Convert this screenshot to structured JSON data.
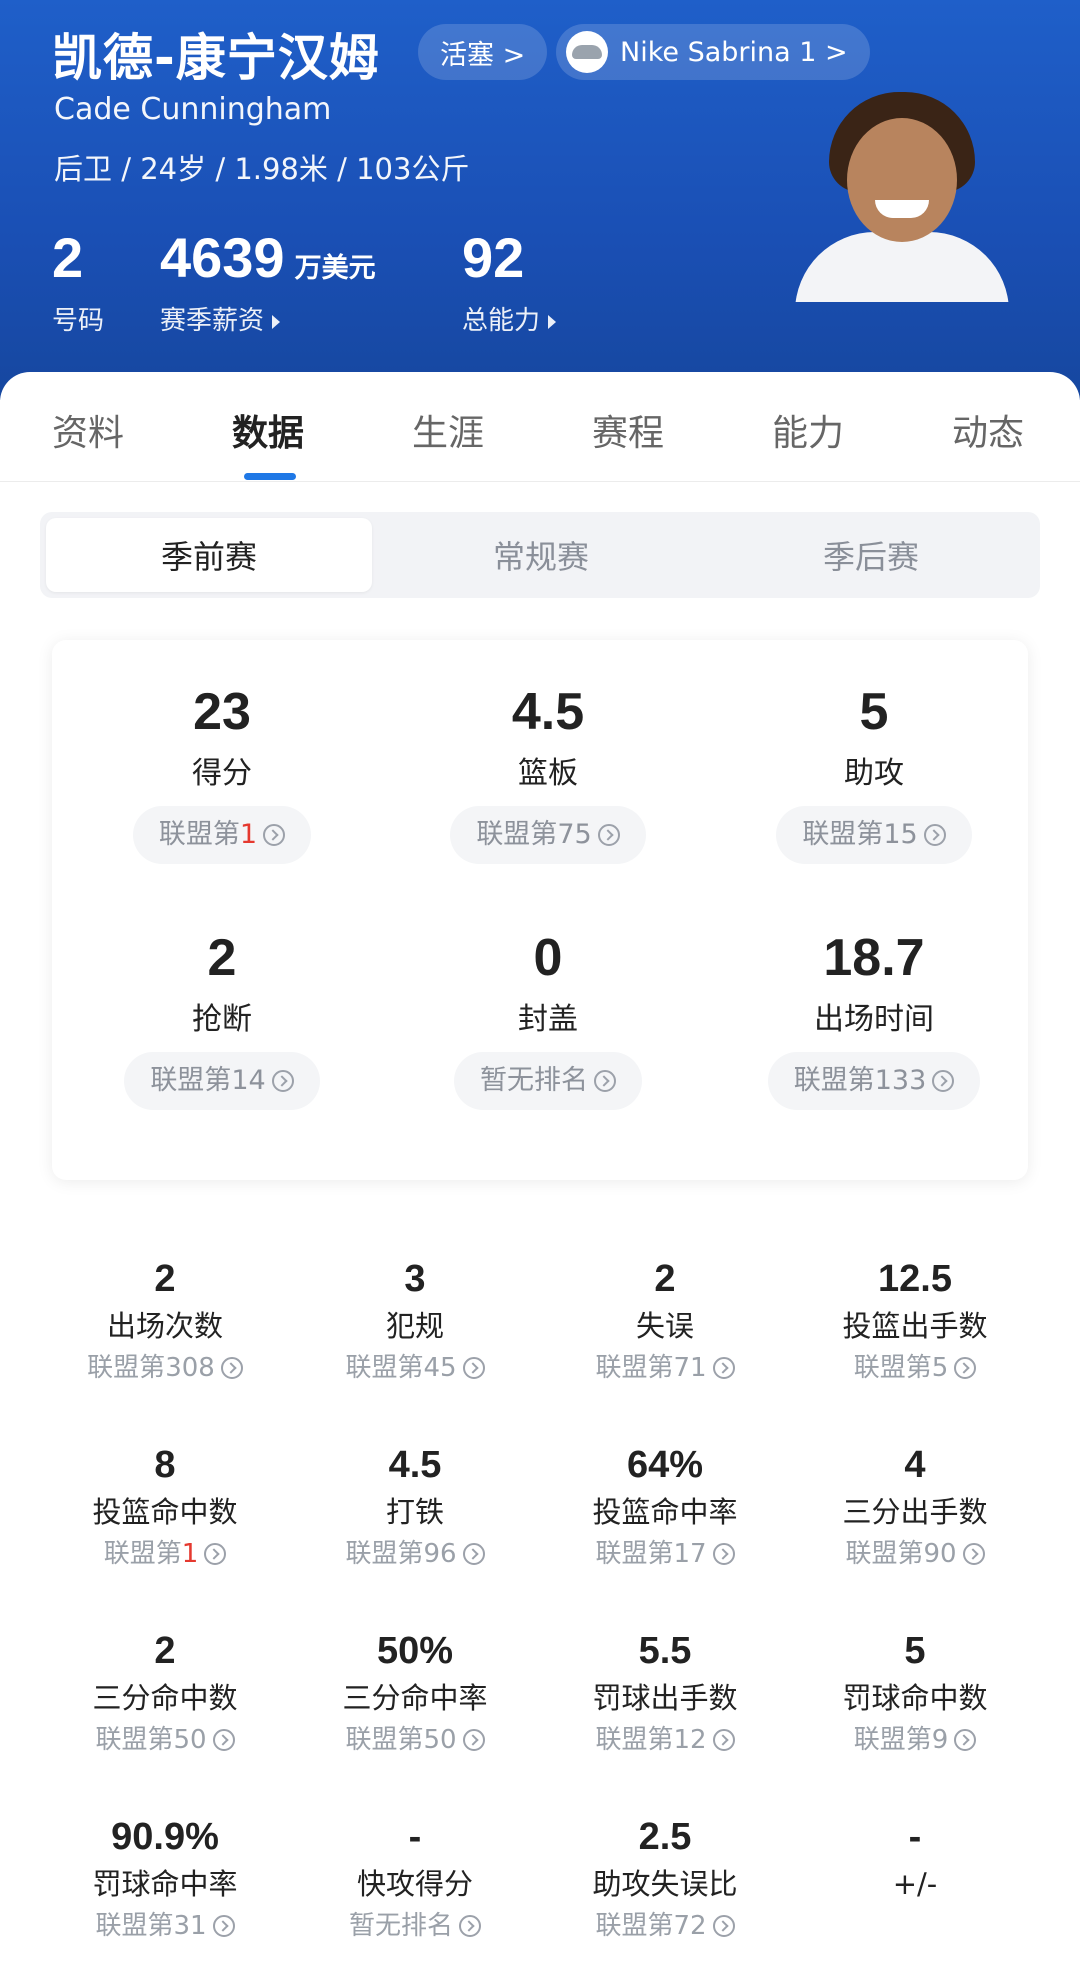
{
  "player": {
    "name_cn": "凯德-康宁汉姆",
    "name_en": "Cade Cunningham",
    "team_label": "活塞 >",
    "shoe_label": "Nike Sabrina 1 >",
    "bio": "后卫 / 24岁 / 1.98米 / 103公斤",
    "number": "2",
    "number_label": "号码",
    "salary": "4639",
    "salary_unit": "万美元",
    "salary_label": "赛季薪资",
    "rating": "92",
    "rating_label": "总能力",
    "accent": "#1f5fc9"
  },
  "tabs": [
    "资料",
    "数据",
    "生涯",
    "赛程",
    "能力",
    "动态"
  ],
  "active_tab": "数据",
  "season_types": [
    "季前赛",
    "常规赛",
    "季后赛"
  ],
  "active_season_type": "季前赛",
  "main_stats": [
    {
      "value": "23",
      "label": "得分",
      "rank_prefix": "联盟第",
      "rank_num": "1",
      "highlight": true
    },
    {
      "value": "4.5",
      "label": "篮板",
      "rank_prefix": "联盟第",
      "rank_num": "75",
      "highlight": false
    },
    {
      "value": "5",
      "label": "助攻",
      "rank_prefix": "联盟第",
      "rank_num": "15",
      "highlight": false
    },
    {
      "value": "2",
      "label": "抢断",
      "rank_prefix": "联盟第",
      "rank_num": "14",
      "highlight": false
    },
    {
      "value": "0",
      "label": "封盖",
      "rank_prefix": "暂无排名",
      "rank_num": "",
      "highlight": false
    },
    {
      "value": "18.7",
      "label": "出场时间",
      "rank_prefix": "联盟第",
      "rank_num": "133",
      "highlight": false
    }
  ],
  "grid_stats": [
    {
      "value": "2",
      "label": "出场次数",
      "rank_prefix": "联盟第",
      "rank_num": "308",
      "highlight": false
    },
    {
      "value": "3",
      "label": "犯规",
      "rank_prefix": "联盟第",
      "rank_num": "45",
      "highlight": false
    },
    {
      "value": "2",
      "label": "失误",
      "rank_prefix": "联盟第",
      "rank_num": "71",
      "highlight": false
    },
    {
      "value": "12.5",
      "label": "投篮出手数",
      "rank_prefix": "联盟第",
      "rank_num": "5",
      "highlight": false
    },
    {
      "value": "8",
      "label": "投篮命中数",
      "rank_prefix": "联盟第",
      "rank_num": "1",
      "highlight": true
    },
    {
      "value": "4.5",
      "label": "打铁",
      "rank_prefix": "联盟第",
      "rank_num": "96",
      "highlight": false
    },
    {
      "value": "64%",
      "label": "投篮命中率",
      "rank_prefix": "联盟第",
      "rank_num": "17",
      "highlight": false
    },
    {
      "value": "4",
      "label": "三分出手数",
      "rank_prefix": "联盟第",
      "rank_num": "90",
      "highlight": false
    },
    {
      "value": "2",
      "label": "三分命中数",
      "rank_prefix": "联盟第",
      "rank_num": "50",
      "highlight": false
    },
    {
      "value": "50%",
      "label": "三分命中率",
      "rank_prefix": "联盟第",
      "rank_num": "50",
      "highlight": false
    },
    {
      "value": "5.5",
      "label": "罚球出手数",
      "rank_prefix": "联盟第",
      "rank_num": "12",
      "highlight": false
    },
    {
      "value": "5",
      "label": "罚球命中数",
      "rank_prefix": "联盟第",
      "rank_num": "9",
      "highlight": false
    },
    {
      "value": "90.9%",
      "label": "罚球命中率",
      "rank_prefix": "联盟第",
      "rank_num": "31",
      "highlight": false
    },
    {
      "value": "-",
      "label": "快攻得分",
      "rank_prefix": "暂无排名",
      "rank_num": "",
      "highlight": false
    },
    {
      "value": "2.5",
      "label": "助攻失误比",
      "rank_prefix": "联盟第",
      "rank_num": "72",
      "highlight": false
    },
    {
      "value": "-",
      "label": "+/-",
      "rank_prefix": "",
      "rank_num": "",
      "highlight": false
    }
  ]
}
